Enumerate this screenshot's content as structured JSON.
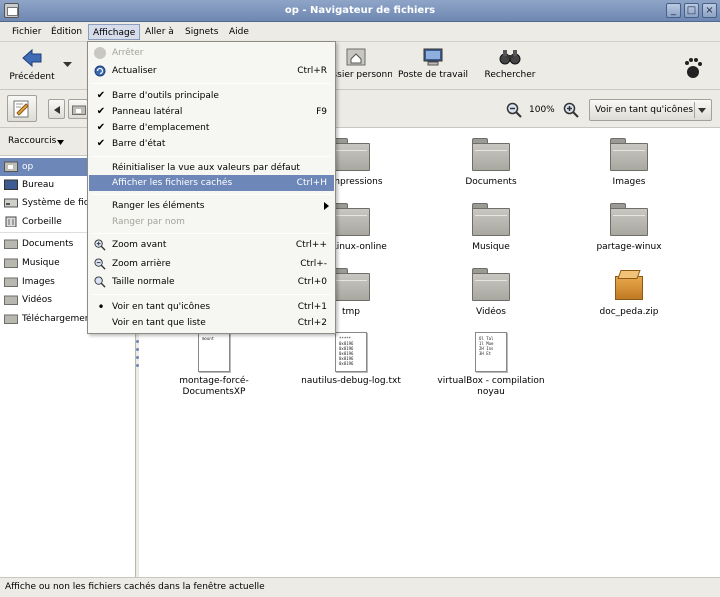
{
  "window": {
    "title": "op - Navigateur de fichiers"
  },
  "menubar": [
    "Fichier",
    "Édition",
    "Affichage",
    "Aller à",
    "Signets",
    "Aide"
  ],
  "toolbar": {
    "back_label": "Précédent",
    "home_label": "Dossier personnel",
    "computer_label": "Poste de travail",
    "search_label": "Rechercher"
  },
  "location": {
    "zoom_level": "100%",
    "view_mode": "Voir en tant qu'icônes"
  },
  "sidebar": {
    "header": "Raccourcis",
    "items": [
      {
        "label": "op",
        "icon": "home-folder-icon",
        "selected": true
      },
      {
        "label": "Bureau",
        "icon": "desktop-icon"
      },
      {
        "label": "Système de fichiers",
        "icon": "filesystem-icon"
      },
      {
        "label": "Corbeille",
        "icon": "trash-icon"
      },
      {
        "label": "Documents",
        "icon": "folder-icon"
      },
      {
        "label": "Musique",
        "icon": "folder-icon"
      },
      {
        "label": "Images",
        "icon": "folder-icon"
      },
      {
        "label": "Vidéos",
        "icon": "folder-icon"
      },
      {
        "label": "Téléchargements",
        "icon": "folder-icon"
      }
    ]
  },
  "files": [
    {
      "name": "Compressions",
      "type": "folder"
    },
    {
      "name": "Documents",
      "type": "folder"
    },
    {
      "name": "Images",
      "type": "folder"
    },
    {
      "name": "EvaLinux-online",
      "type": "folder"
    },
    {
      "name": "Musique",
      "type": "folder"
    },
    {
      "name": "partage-winux",
      "type": "folder"
    },
    {
      "name": "tmp",
      "type": "folder"
    },
    {
      "name": "Vidéos",
      "type": "folder"
    },
    {
      "name": "doc_peda.zip",
      "type": "archive"
    },
    {
      "name": "montage-forcé-DocumentsXP",
      "type": "text"
    },
    {
      "name": "nautilus-debug-log.txt",
      "type": "text"
    },
    {
      "name": "virtualBox - compilation noyau",
      "type": "text"
    }
  ],
  "view_menu": {
    "items": [
      {
        "label": "Arrêter",
        "accel": "",
        "disabled": true,
        "icon": "stop-icon"
      },
      {
        "label": "Actualiser",
        "accel": "Ctrl+R",
        "icon": "refresh-icon"
      },
      {
        "label": "Barre d'outils principale",
        "accel": "",
        "checked": true
      },
      {
        "label": "Panneau latéral",
        "accel": "F9",
        "checked": true
      },
      {
        "label": "Barre d'emplacement",
        "accel": "",
        "checked": true
      },
      {
        "label": "Barre d'état",
        "accel": "",
        "checked": true
      },
      {
        "label": "Réinitialiser la vue aux valeurs par défaut",
        "accel": ""
      },
      {
        "label": "Afficher les fichiers cachés",
        "accel": "Ctrl+H",
        "highlighted": true
      },
      {
        "label": "Ranger les éléments",
        "accel": "",
        "submenu": true
      },
      {
        "label": "Ranger par nom",
        "accel": "",
        "disabled": true
      },
      {
        "label": "Zoom avant",
        "accel": "Ctrl++",
        "icon": "zoom-in-icon"
      },
      {
        "label": "Zoom arrière",
        "accel": "Ctrl+-",
        "icon": "zoom-out-icon"
      },
      {
        "label": "Taille normale",
        "accel": "Ctrl+0",
        "icon": "zoom-normal-icon"
      },
      {
        "label": "Voir en tant qu'icônes",
        "accel": "Ctrl+1",
        "radio": true
      },
      {
        "label": "Voir en tant que liste",
        "accel": "Ctrl+2"
      }
    ]
  },
  "statusbar": {
    "text": "Affiche ou non les fichiers cachés dans la fenêtre actuelle"
  },
  "colors": {
    "selection": "#6d87b8",
    "titlebar": "#7f96be"
  }
}
